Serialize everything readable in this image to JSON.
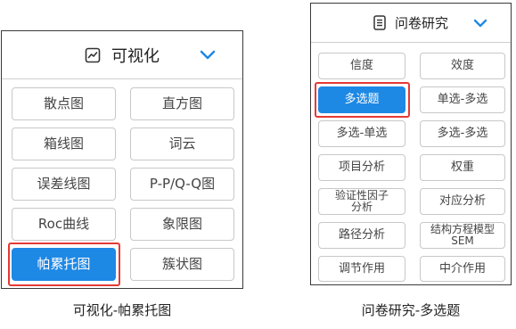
{
  "colors": {
    "accent": "#1e88e5",
    "highlight": "#e53935",
    "border": "#3a3a3a"
  },
  "left_panel": {
    "title": "可视化",
    "icon": "line-chart-icon",
    "chevron": "chevron-down-icon",
    "buttons": [
      {
        "label": "散点图",
        "active": false
      },
      {
        "label": "直方图",
        "active": false
      },
      {
        "label": "箱线图",
        "active": false
      },
      {
        "label": "词云",
        "active": false
      },
      {
        "label": "误差线图",
        "active": false
      },
      {
        "label": "P-P/Q-Q图",
        "active": false
      },
      {
        "label": "Roc曲线",
        "active": false
      },
      {
        "label": "象限图",
        "active": false
      },
      {
        "label": "帕累托图",
        "active": true
      },
      {
        "label": "簇状图",
        "active": false
      }
    ],
    "caption": "可视化-帕累托图"
  },
  "right_panel": {
    "title": "问卷研究",
    "icon": "document-icon",
    "chevron": "chevron-down-icon",
    "buttons": [
      {
        "label": "信度",
        "active": false
      },
      {
        "label": "效度",
        "active": false
      },
      {
        "label": "多选题",
        "active": true
      },
      {
        "label": "单选-多选",
        "active": false
      },
      {
        "label": "多选-单选",
        "active": false
      },
      {
        "label": "多选-多选",
        "active": false
      },
      {
        "label": "项目分析",
        "active": false
      },
      {
        "label": "权重",
        "active": false
      },
      {
        "label": "验证性因子分析",
        "line1": "验证性因子",
        "line2": "分析",
        "active": false
      },
      {
        "label": "对应分析",
        "active": false
      },
      {
        "label": "路径分析",
        "active": false
      },
      {
        "label": "结构方程模型SEM",
        "line1": "结构方程模型",
        "line2": "SEM",
        "active": false
      },
      {
        "label": "调节作用",
        "active": false
      },
      {
        "label": "中介作用",
        "active": false
      }
    ],
    "caption": "问卷研究-多选题"
  }
}
